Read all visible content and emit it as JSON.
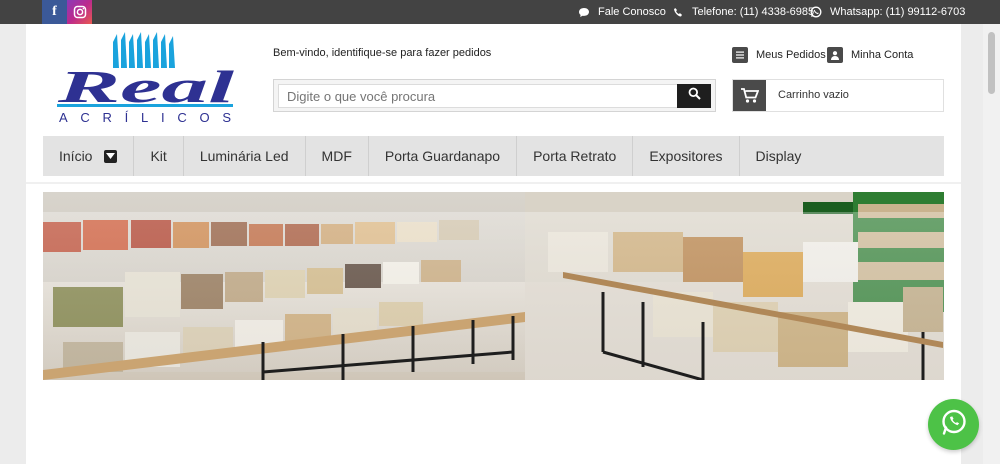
{
  "topbar": {
    "social": [
      {
        "name": "facebook-icon",
        "glyph": "f"
      },
      {
        "name": "instagram-icon"
      }
    ],
    "contact": "Fale Conosco",
    "phone": "Telefone: (11) 4338-6985",
    "whatsapp": "Whatsapp: (11) 99112-6703"
  },
  "header": {
    "logo": {
      "brand": "Real",
      "tagline": "ACRÍLICOS"
    },
    "welcome": {
      "prefix": "Bem-vindo, ",
      "link": "identifique-se",
      "suffix": " para fazer pedidos"
    },
    "search": {
      "placeholder": "Digite o que você procura"
    },
    "account": {
      "orders": "Meus Pedidos",
      "my_account": "Minha Conta"
    },
    "cart": {
      "label": "Carrinho vazio"
    }
  },
  "nav": {
    "items": [
      "Início",
      "Kit",
      "Luminária Led",
      "MDF",
      "Porta Guardanapo",
      "Porta Retrato",
      "Expositores",
      "Display"
    ]
  },
  "colors": {
    "topbar": "#434343",
    "brand_blue": "#2e3192",
    "logo_cyan": "#1aa3dd",
    "whatsapp": "#4dc247",
    "nav_bg": "#e3e3e3"
  }
}
